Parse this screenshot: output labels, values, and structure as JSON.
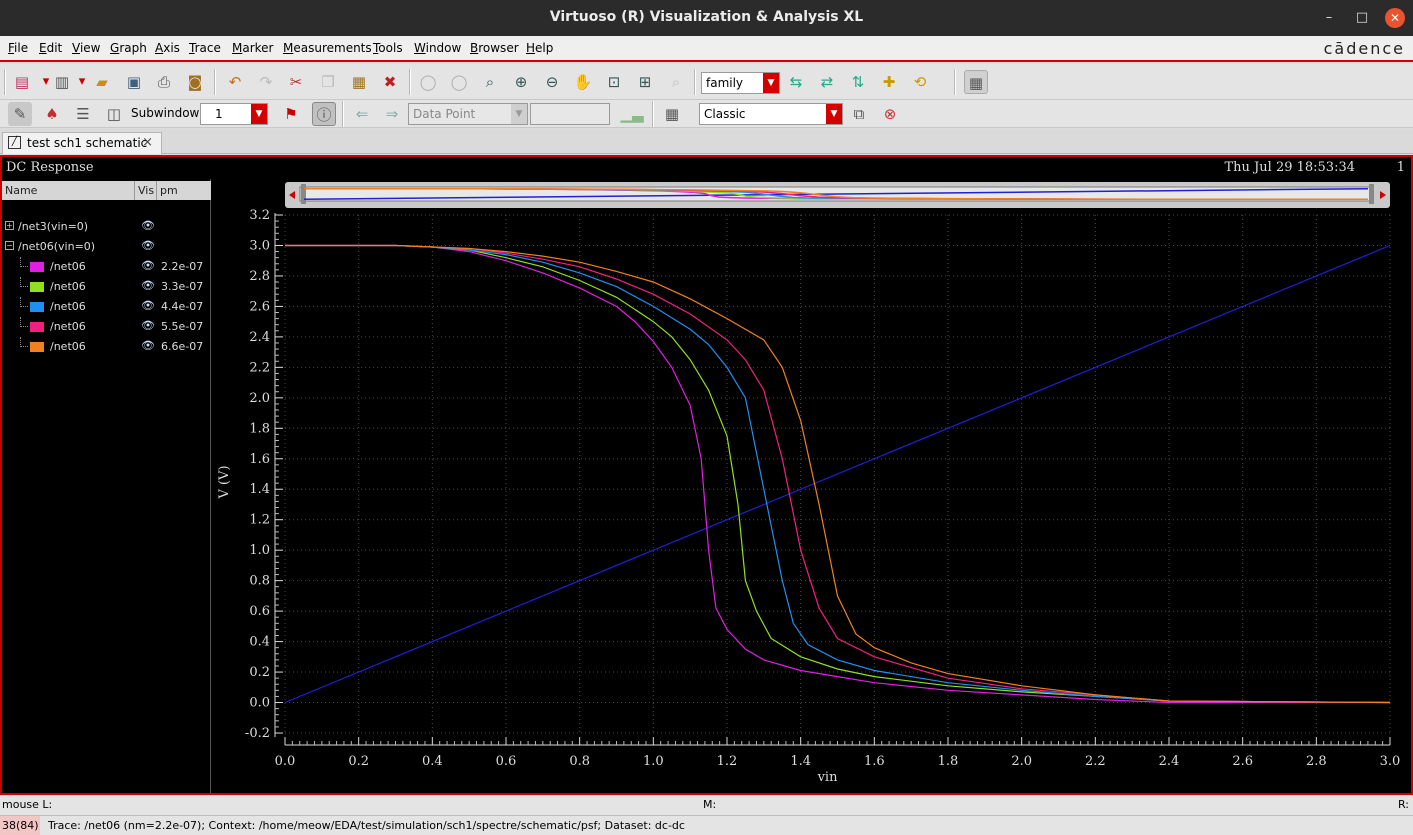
{
  "window": {
    "title": "Virtuoso (R) Visualization & Analysis XL"
  },
  "menubar": {
    "items": [
      "File",
      "Edit",
      "View",
      "Graph",
      "Axis",
      "Trace",
      "Marker",
      "Measurements",
      "Tools",
      "Window",
      "Browser",
      "Help"
    ],
    "logo": "cādence"
  },
  "toolbar1": {
    "family_select": "family"
  },
  "toolbar2": {
    "subwindows_label": "Subwindows:",
    "subwindows_value": "1",
    "marker_type": "Data Point",
    "marker_value": "",
    "style_select": "Classic"
  },
  "tab": {
    "label": "test sch1 schematic",
    "close": "×"
  },
  "plot_window": {
    "title": "DC Response",
    "date": "Thu Jul 29 18:53:34",
    "number": "1"
  },
  "legend": {
    "headers": {
      "name": "Name",
      "vis": "Vis",
      "pm": "pm"
    },
    "groups": [
      {
        "name": "/net3(vin=0)",
        "expander": "+",
        "children": []
      },
      {
        "name": "/net06(vin=0)",
        "expander": "−",
        "children": [
          {
            "name": "/net06",
            "pm": "2.2e-07",
            "color": "#e020e0"
          },
          {
            "name": "/net06",
            "pm": "3.3e-07",
            "color": "#90e020"
          },
          {
            "name": "/net06",
            "pm": "4.4e-07",
            "color": "#2090f0"
          },
          {
            "name": "/net06",
            "pm": "5.5e-07",
            "color": "#f02080"
          },
          {
            "name": "/net06",
            "pm": "6.6e-07",
            "color": "#f08020"
          }
        ]
      }
    ]
  },
  "chart_data": {
    "type": "line",
    "xlabel": "vin",
    "ylabel": "V (V)",
    "xlim": [
      0,
      3.0
    ],
    "ylim": [
      -0.2,
      3.2
    ],
    "xticks": [
      "0.0",
      "0.2",
      "0.4",
      "0.6",
      "0.8",
      "1.0",
      "1.2",
      "1.4",
      "1.6",
      "1.8",
      "2.0",
      "2.2",
      "2.4",
      "2.6",
      "2.8",
      "3.0"
    ],
    "yticks": [
      "-0.2",
      "0.0",
      "0.2",
      "0.4",
      "0.6",
      "0.8",
      "1.0",
      "1.2",
      "1.4",
      "1.6",
      "1.8",
      "2.0",
      "2.2",
      "2.4",
      "2.6",
      "2.8",
      "3.0",
      "3.2"
    ],
    "grid": true,
    "series": [
      {
        "name": "/net3(vin=0)",
        "color": "#2020d8",
        "x": [
          0,
          3.0
        ],
        "y": [
          0,
          3.0
        ]
      },
      {
        "name": "2.2e-07",
        "color": "#e020e0",
        "x": [
          0,
          0.3,
          0.4,
          0.5,
          0.6,
          0.7,
          0.8,
          0.9,
          0.95,
          1.0,
          1.05,
          1.1,
          1.13,
          1.15,
          1.17,
          1.2,
          1.25,
          1.3,
          1.4,
          1.5,
          1.6,
          1.8,
          2.0,
          2.2,
          2.4,
          3.0
        ],
        "y": [
          3.0,
          3.0,
          2.99,
          2.96,
          2.9,
          2.82,
          2.72,
          2.6,
          2.5,
          2.37,
          2.2,
          1.95,
          1.6,
          1.0,
          0.62,
          0.48,
          0.35,
          0.28,
          0.21,
          0.17,
          0.13,
          0.08,
          0.05,
          0.02,
          0.0,
          0.0
        ]
      },
      {
        "name": "3.3e-07",
        "color": "#90e020",
        "x": [
          0,
          0.3,
          0.4,
          0.5,
          0.6,
          0.7,
          0.8,
          0.9,
          1.0,
          1.05,
          1.1,
          1.15,
          1.2,
          1.23,
          1.25,
          1.28,
          1.32,
          1.4,
          1.5,
          1.6,
          1.8,
          2.0,
          2.2,
          2.4,
          3.0
        ],
        "y": [
          3.0,
          3.0,
          2.99,
          2.97,
          2.92,
          2.86,
          2.77,
          2.66,
          2.5,
          2.4,
          2.25,
          2.05,
          1.75,
          1.3,
          0.8,
          0.6,
          0.42,
          0.3,
          0.22,
          0.17,
          0.11,
          0.07,
          0.04,
          0.01,
          0.0
        ]
      },
      {
        "name": "4.4e-07",
        "color": "#2090f0",
        "x": [
          0,
          0.3,
          0.4,
          0.5,
          0.6,
          0.7,
          0.8,
          0.9,
          1.0,
          1.1,
          1.15,
          1.2,
          1.25,
          1.3,
          1.35,
          1.38,
          1.42,
          1.5,
          1.6,
          1.8,
          2.0,
          2.2,
          2.4,
          3.0
        ],
        "y": [
          3.0,
          3.0,
          2.99,
          2.97,
          2.94,
          2.89,
          2.82,
          2.73,
          2.6,
          2.45,
          2.35,
          2.2,
          2.0,
          1.4,
          0.8,
          0.52,
          0.38,
          0.28,
          0.21,
          0.13,
          0.08,
          0.04,
          0.01,
          0.0
        ]
      },
      {
        "name": "5.5e-07",
        "color": "#f02080",
        "x": [
          0,
          0.3,
          0.4,
          0.5,
          0.6,
          0.7,
          0.8,
          0.9,
          1.0,
          1.1,
          1.2,
          1.25,
          1.3,
          1.35,
          1.4,
          1.45,
          1.5,
          1.6,
          1.8,
          2.0,
          2.2,
          2.4,
          3.0
        ],
        "y": [
          3.0,
          3.0,
          2.99,
          2.98,
          2.95,
          2.91,
          2.86,
          2.78,
          2.68,
          2.55,
          2.38,
          2.25,
          2.05,
          1.6,
          1.0,
          0.62,
          0.42,
          0.3,
          0.16,
          0.09,
          0.05,
          0.01,
          0.0
        ]
      },
      {
        "name": "6.6e-07",
        "color": "#f08020",
        "x": [
          0,
          0.3,
          0.4,
          0.5,
          0.6,
          0.7,
          0.8,
          0.9,
          1.0,
          1.1,
          1.2,
          1.3,
          1.35,
          1.4,
          1.45,
          1.5,
          1.55,
          1.6,
          1.7,
          1.8,
          2.0,
          2.2,
          2.4,
          3.0
        ],
        "y": [
          3.0,
          3.0,
          2.99,
          2.98,
          2.96,
          2.93,
          2.89,
          2.83,
          2.76,
          2.65,
          2.52,
          2.38,
          2.2,
          1.85,
          1.3,
          0.7,
          0.45,
          0.36,
          0.26,
          0.19,
          0.11,
          0.05,
          0.01,
          0.0
        ]
      }
    ]
  },
  "statusbar": {
    "mouse_l": "mouse L:",
    "mouse_m": "M:",
    "mouse_r": "R:",
    "count": "38(84)",
    "message": "Trace: /net06 (nm=2.2e-07); Context: /home/meow/EDA/test/simulation/sch1/spectre/schematic/psf; Dataset: dc-dc"
  }
}
